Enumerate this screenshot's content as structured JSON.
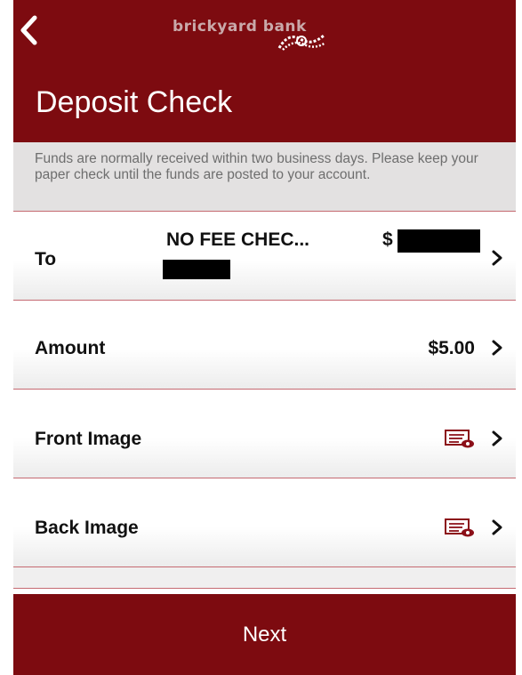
{
  "header": {
    "back_icon": "chevron-left-icon",
    "logo_text": "brickyard bank",
    "title": "Deposit Check"
  },
  "info": {
    "text": "Funds are normally received within two business days. Please keep your paper check until the funds are posted to your account."
  },
  "rows": {
    "to": {
      "label": "To",
      "account_name": "NO FEE CHEC...",
      "balance_prefix": "$"
    },
    "amount": {
      "label": "Amount",
      "value": "$5.00"
    },
    "front": {
      "label": "Front Image",
      "icon": "check-image-icon"
    },
    "back": {
      "label": "Back Image",
      "icon": "check-image-icon"
    }
  },
  "footer": {
    "next_label": "Next"
  },
  "colors": {
    "brand": "#7d0b10",
    "divider": "#c56a72",
    "banner_bg": "#e3e1e1",
    "icon_accent": "#8b0f18"
  }
}
